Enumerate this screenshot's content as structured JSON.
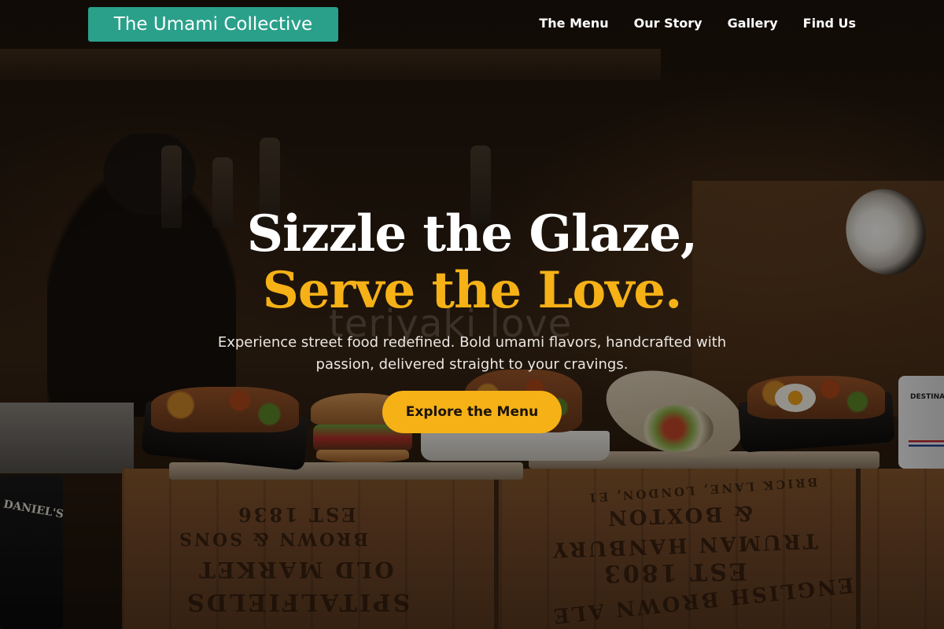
{
  "brand": {
    "name": "The Umami Collective",
    "accent_color": "#2aa08a"
  },
  "nav": {
    "links": [
      {
        "label": "The Menu"
      },
      {
        "label": "Our Story"
      },
      {
        "label": "Gallery"
      },
      {
        "label": "Find Us"
      }
    ]
  },
  "hero": {
    "headline_line1": "Sizzle the Glaze,",
    "headline_line2": "Serve the Love.",
    "highlight_color": "#f5b116",
    "subtext": "Experience street food redefined. Bold umami flavors, handcrafted with passion, delivered straight to your cravings.",
    "cta_label": "Explore the Menu",
    "background_watermark": "teriyaki love"
  },
  "scene": {
    "crate_left_lines": [
      "EST 1836",
      "BROWN & SONS",
      "OLD MARKET",
      "SPITALFIELDS"
    ],
    "crate_right_lines": [
      "BRICK LANE, LONDON, E1",
      "& BOXTON",
      "TRUMAN HANBURY",
      "EST 1803",
      "ENGLISH BROWN ALE"
    ],
    "bottle_label": "DANIEL'S",
    "mug_label": "DESTINATI"
  }
}
